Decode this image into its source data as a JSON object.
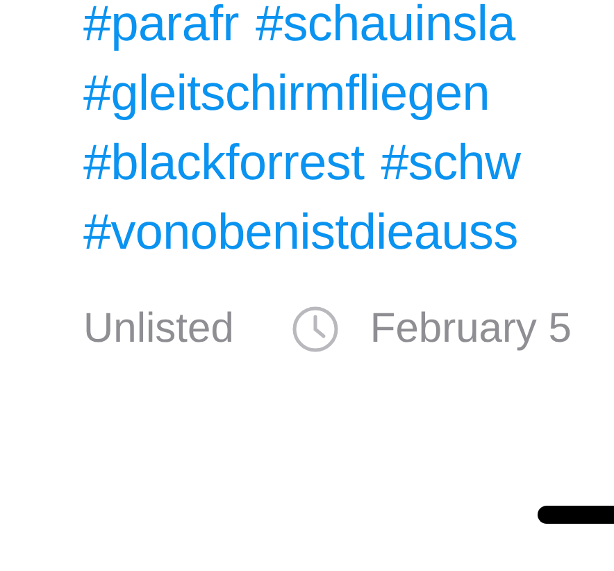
{
  "hashtag_lines": [
    [
      "#parafr",
      "#schauinsla"
    ],
    [
      "#gleitschirmfliegen"
    ],
    [
      "#blackforrest",
      "#schw"
    ],
    [
      "#vonobenistdieauss"
    ]
  ],
  "meta": {
    "visibility": "Unlisted",
    "date": "February 5"
  }
}
